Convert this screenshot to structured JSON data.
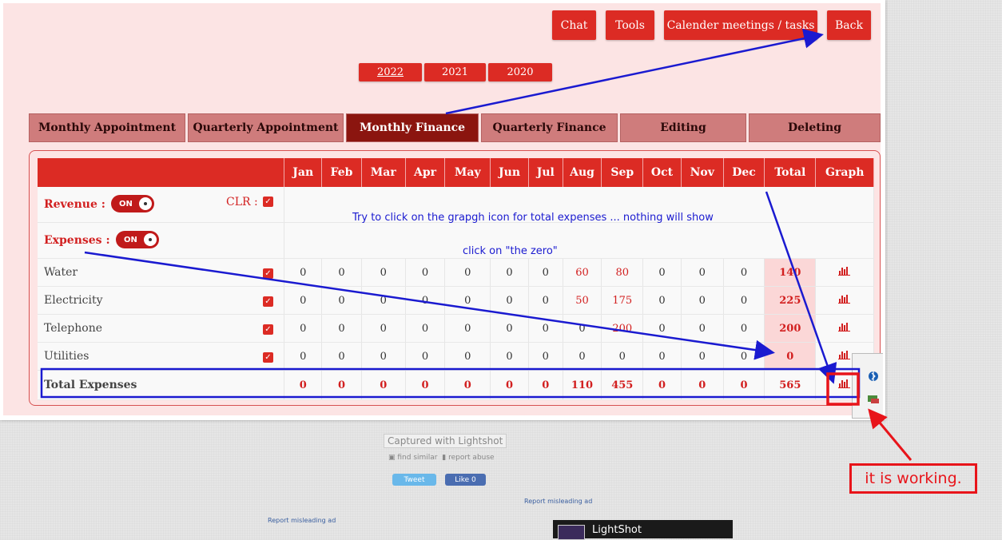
{
  "topbar": {
    "chat": "Chat",
    "tools": "Tools",
    "calendar": "Calender meetings / tasks",
    "back": "Back"
  },
  "years": [
    "2022",
    "2021",
    "2020"
  ],
  "tabs": [
    "Monthly Appointment",
    "Quarterly Appointment",
    "Monthly Finance",
    "Quarterly Finance",
    "Editing",
    "Deleting"
  ],
  "active_tab": "Monthly Finance",
  "table": {
    "headers": [
      "Jan",
      "Feb",
      "Mar",
      "Apr",
      "May",
      "Jun",
      "Jul",
      "Aug",
      "Sep",
      "Oct",
      "Nov",
      "Dec",
      "Total",
      "Graph"
    ],
    "revenue_label": "Revenue :",
    "expenses_label": "Expenses :",
    "clr_label": "CLR :",
    "toggle_on": "ON",
    "rows": [
      {
        "label": "Water",
        "values": [
          "0",
          "0",
          "0",
          "0",
          "0",
          "0",
          "0",
          "60",
          "80",
          "0",
          "0",
          "0"
        ],
        "total": "140"
      },
      {
        "label": "Electricity",
        "values": [
          "0",
          "0",
          "0",
          "0",
          "0",
          "0",
          "0",
          "50",
          "175",
          "0",
          "0",
          "0"
        ],
        "total": "225"
      },
      {
        "label": "Telephone",
        "values": [
          "0",
          "0",
          "0",
          "0",
          "0",
          "0",
          "0",
          "0",
          "200",
          "0",
          "0",
          "0"
        ],
        "total": "200"
      },
      {
        "label": "Utilities",
        "values": [
          "0",
          "0",
          "0",
          "0",
          "0",
          "0",
          "0",
          "0",
          "0",
          "0",
          "0",
          "0"
        ],
        "total": "0"
      }
    ],
    "total_row": {
      "label": "Total Expenses",
      "values": [
        "0",
        "0",
        "0",
        "0",
        "0",
        "0",
        "0",
        "110",
        "455",
        "0",
        "0",
        "0"
      ],
      "total": "565"
    }
  },
  "annotations": {
    "note1": "Try to click on the grapgh icon for total expenses ... nothing will show",
    "note2": "click on \"the zero\"",
    "callout": "it is working."
  },
  "footer": {
    "captured": "Captured with Lightshot",
    "find_similar": "find similar",
    "report_abuse": "report abuse",
    "tweet": "Tweet",
    "like": "Like 0",
    "misleading_ad": "Report misleading ad",
    "lightshot": "LightShot"
  },
  "colors": {
    "accent": "#dc2b24",
    "page_bg": "#fce4e4",
    "annotation_blue": "#1a1ad0",
    "annotation_red": "#e8141a"
  }
}
